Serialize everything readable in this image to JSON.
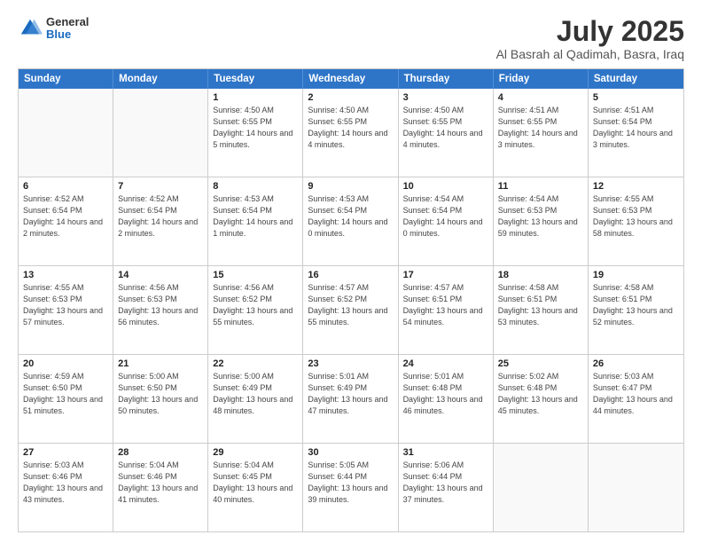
{
  "logo": {
    "general": "General",
    "blue": "Blue"
  },
  "title": {
    "month": "July 2025",
    "location": "Al Basrah al Qadimah, Basra, Iraq"
  },
  "header_days": [
    "Sunday",
    "Monday",
    "Tuesday",
    "Wednesday",
    "Thursday",
    "Friday",
    "Saturday"
  ],
  "weeks": [
    [
      {
        "day": "",
        "sunrise": "",
        "sunset": "",
        "daylight": ""
      },
      {
        "day": "",
        "sunrise": "",
        "sunset": "",
        "daylight": ""
      },
      {
        "day": "1",
        "sunrise": "Sunrise: 4:50 AM",
        "sunset": "Sunset: 6:55 PM",
        "daylight": "Daylight: 14 hours and 5 minutes."
      },
      {
        "day": "2",
        "sunrise": "Sunrise: 4:50 AM",
        "sunset": "Sunset: 6:55 PM",
        "daylight": "Daylight: 14 hours and 4 minutes."
      },
      {
        "day": "3",
        "sunrise": "Sunrise: 4:50 AM",
        "sunset": "Sunset: 6:55 PM",
        "daylight": "Daylight: 14 hours and 4 minutes."
      },
      {
        "day": "4",
        "sunrise": "Sunrise: 4:51 AM",
        "sunset": "Sunset: 6:55 PM",
        "daylight": "Daylight: 14 hours and 3 minutes."
      },
      {
        "day": "5",
        "sunrise": "Sunrise: 4:51 AM",
        "sunset": "Sunset: 6:54 PM",
        "daylight": "Daylight: 14 hours and 3 minutes."
      }
    ],
    [
      {
        "day": "6",
        "sunrise": "Sunrise: 4:52 AM",
        "sunset": "Sunset: 6:54 PM",
        "daylight": "Daylight: 14 hours and 2 minutes."
      },
      {
        "day": "7",
        "sunrise": "Sunrise: 4:52 AM",
        "sunset": "Sunset: 6:54 PM",
        "daylight": "Daylight: 14 hours and 2 minutes."
      },
      {
        "day": "8",
        "sunrise": "Sunrise: 4:53 AM",
        "sunset": "Sunset: 6:54 PM",
        "daylight": "Daylight: 14 hours and 1 minute."
      },
      {
        "day": "9",
        "sunrise": "Sunrise: 4:53 AM",
        "sunset": "Sunset: 6:54 PM",
        "daylight": "Daylight: 14 hours and 0 minutes."
      },
      {
        "day": "10",
        "sunrise": "Sunrise: 4:54 AM",
        "sunset": "Sunset: 6:54 PM",
        "daylight": "Daylight: 14 hours and 0 minutes."
      },
      {
        "day": "11",
        "sunrise": "Sunrise: 4:54 AM",
        "sunset": "Sunset: 6:53 PM",
        "daylight": "Daylight: 13 hours and 59 minutes."
      },
      {
        "day": "12",
        "sunrise": "Sunrise: 4:55 AM",
        "sunset": "Sunset: 6:53 PM",
        "daylight": "Daylight: 13 hours and 58 minutes."
      }
    ],
    [
      {
        "day": "13",
        "sunrise": "Sunrise: 4:55 AM",
        "sunset": "Sunset: 6:53 PM",
        "daylight": "Daylight: 13 hours and 57 minutes."
      },
      {
        "day": "14",
        "sunrise": "Sunrise: 4:56 AM",
        "sunset": "Sunset: 6:53 PM",
        "daylight": "Daylight: 13 hours and 56 minutes."
      },
      {
        "day": "15",
        "sunrise": "Sunrise: 4:56 AM",
        "sunset": "Sunset: 6:52 PM",
        "daylight": "Daylight: 13 hours and 55 minutes."
      },
      {
        "day": "16",
        "sunrise": "Sunrise: 4:57 AM",
        "sunset": "Sunset: 6:52 PM",
        "daylight": "Daylight: 13 hours and 55 minutes."
      },
      {
        "day": "17",
        "sunrise": "Sunrise: 4:57 AM",
        "sunset": "Sunset: 6:51 PM",
        "daylight": "Daylight: 13 hours and 54 minutes."
      },
      {
        "day": "18",
        "sunrise": "Sunrise: 4:58 AM",
        "sunset": "Sunset: 6:51 PM",
        "daylight": "Daylight: 13 hours and 53 minutes."
      },
      {
        "day": "19",
        "sunrise": "Sunrise: 4:58 AM",
        "sunset": "Sunset: 6:51 PM",
        "daylight": "Daylight: 13 hours and 52 minutes."
      }
    ],
    [
      {
        "day": "20",
        "sunrise": "Sunrise: 4:59 AM",
        "sunset": "Sunset: 6:50 PM",
        "daylight": "Daylight: 13 hours and 51 minutes."
      },
      {
        "day": "21",
        "sunrise": "Sunrise: 5:00 AM",
        "sunset": "Sunset: 6:50 PM",
        "daylight": "Daylight: 13 hours and 50 minutes."
      },
      {
        "day": "22",
        "sunrise": "Sunrise: 5:00 AM",
        "sunset": "Sunset: 6:49 PM",
        "daylight": "Daylight: 13 hours and 48 minutes."
      },
      {
        "day": "23",
        "sunrise": "Sunrise: 5:01 AM",
        "sunset": "Sunset: 6:49 PM",
        "daylight": "Daylight: 13 hours and 47 minutes."
      },
      {
        "day": "24",
        "sunrise": "Sunrise: 5:01 AM",
        "sunset": "Sunset: 6:48 PM",
        "daylight": "Daylight: 13 hours and 46 minutes."
      },
      {
        "day": "25",
        "sunrise": "Sunrise: 5:02 AM",
        "sunset": "Sunset: 6:48 PM",
        "daylight": "Daylight: 13 hours and 45 minutes."
      },
      {
        "day": "26",
        "sunrise": "Sunrise: 5:03 AM",
        "sunset": "Sunset: 6:47 PM",
        "daylight": "Daylight: 13 hours and 44 minutes."
      }
    ],
    [
      {
        "day": "27",
        "sunrise": "Sunrise: 5:03 AM",
        "sunset": "Sunset: 6:46 PM",
        "daylight": "Daylight: 13 hours and 43 minutes."
      },
      {
        "day": "28",
        "sunrise": "Sunrise: 5:04 AM",
        "sunset": "Sunset: 6:46 PM",
        "daylight": "Daylight: 13 hours and 41 minutes."
      },
      {
        "day": "29",
        "sunrise": "Sunrise: 5:04 AM",
        "sunset": "Sunset: 6:45 PM",
        "daylight": "Daylight: 13 hours and 40 minutes."
      },
      {
        "day": "30",
        "sunrise": "Sunrise: 5:05 AM",
        "sunset": "Sunset: 6:44 PM",
        "daylight": "Daylight: 13 hours and 39 minutes."
      },
      {
        "day": "31",
        "sunrise": "Sunrise: 5:06 AM",
        "sunset": "Sunset: 6:44 PM",
        "daylight": "Daylight: 13 hours and 37 minutes."
      },
      {
        "day": "",
        "sunrise": "",
        "sunset": "",
        "daylight": ""
      },
      {
        "day": "",
        "sunrise": "",
        "sunset": "",
        "daylight": ""
      }
    ]
  ]
}
